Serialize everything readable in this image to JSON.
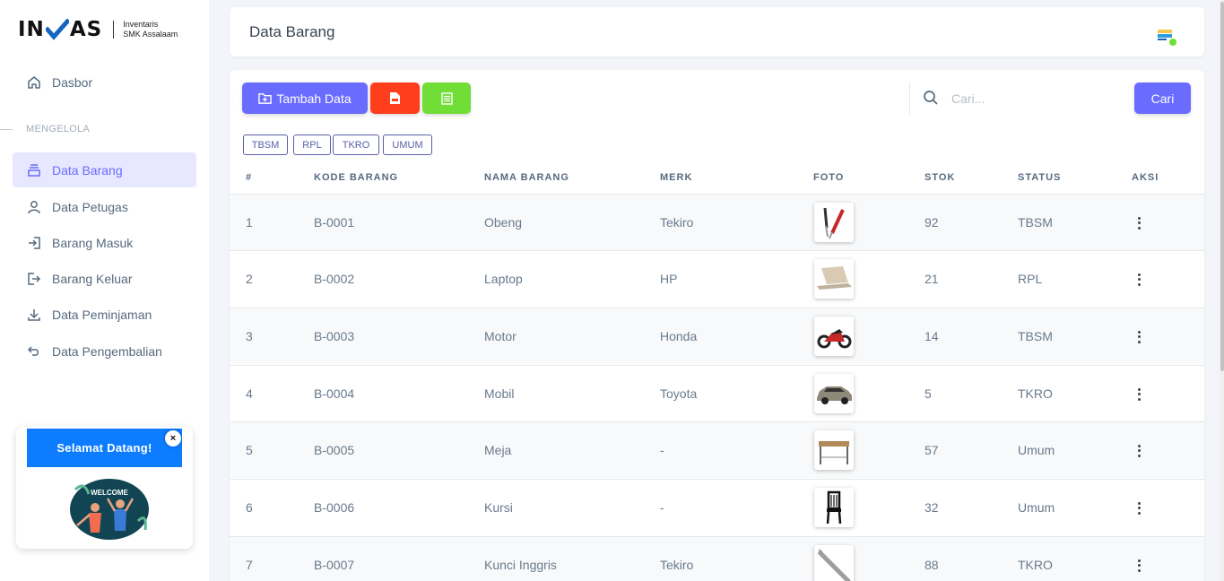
{
  "brand": {
    "logo_text_1": "IN",
    "logo_text_2": "AS",
    "subtitle_1": "Inventaris",
    "subtitle_2": "SMK Assalaam"
  },
  "sidebar": {
    "dashboard": "Dasbor",
    "section_header": "MENGELOLA",
    "items": [
      {
        "label": "Data Barang",
        "icon": "inventory-icon",
        "active": true
      },
      {
        "label": "Data Petugas",
        "icon": "user-icon"
      },
      {
        "label": "Barang Masuk",
        "icon": "log-in-icon"
      },
      {
        "label": "Barang Keluar",
        "icon": "log-out-icon"
      },
      {
        "label": "Data Peminjaman",
        "icon": "download-icon"
      },
      {
        "label": "Data Pengembalian",
        "icon": "undo-icon"
      }
    ]
  },
  "welcome": {
    "title": "Selamat Datang!",
    "close": "×",
    "image_text": "WELCOME"
  },
  "header": {
    "title": "Data Barang"
  },
  "toolbar": {
    "add_label": "Tambah Data",
    "search_placeholder": "Cari...",
    "search_button": "Cari"
  },
  "filters": [
    "TBSM",
    "RPL",
    "TKRO",
    "UMUM"
  ],
  "table": {
    "headers": [
      "#",
      "KODE BARANG",
      "NAMA BARANG",
      "MERK",
      "FOTO",
      "STOK",
      "STATUS",
      "AKSI"
    ],
    "rows": [
      {
        "no": "1",
        "kode": "B-0001",
        "nama": "Obeng",
        "merk": "Tekiro",
        "foto": "screwdriver",
        "stok": "92",
        "status": "TBSM"
      },
      {
        "no": "2",
        "kode": "B-0002",
        "nama": "Laptop",
        "merk": "HP",
        "foto": "laptop",
        "stok": "21",
        "status": "RPL"
      },
      {
        "no": "3",
        "kode": "B-0003",
        "nama": "Motor",
        "merk": "Honda",
        "foto": "motorcycle",
        "stok": "14",
        "status": "TBSM"
      },
      {
        "no": "4",
        "kode": "B-0004",
        "nama": "Mobil",
        "merk": "Toyota",
        "foto": "car",
        "stok": "5",
        "status": "TKRO"
      },
      {
        "no": "5",
        "kode": "B-0005",
        "nama": "Meja",
        "merk": "-",
        "foto": "table",
        "stok": "57",
        "status": "Umum"
      },
      {
        "no": "6",
        "kode": "B-0006",
        "nama": "Kursi",
        "merk": "-",
        "foto": "chair",
        "stok": "32",
        "status": "Umum"
      },
      {
        "no": "7",
        "kode": "B-0007",
        "nama": "Kunci Inggris",
        "merk": "Tekiro",
        "foto": "wrench",
        "stok": "88",
        "status": "TKRO"
      }
    ]
  },
  "colors": {
    "primary": "#696cff",
    "danger": "#ff3e1d",
    "success": "#71dd37",
    "welcome": "#0d7cff"
  }
}
